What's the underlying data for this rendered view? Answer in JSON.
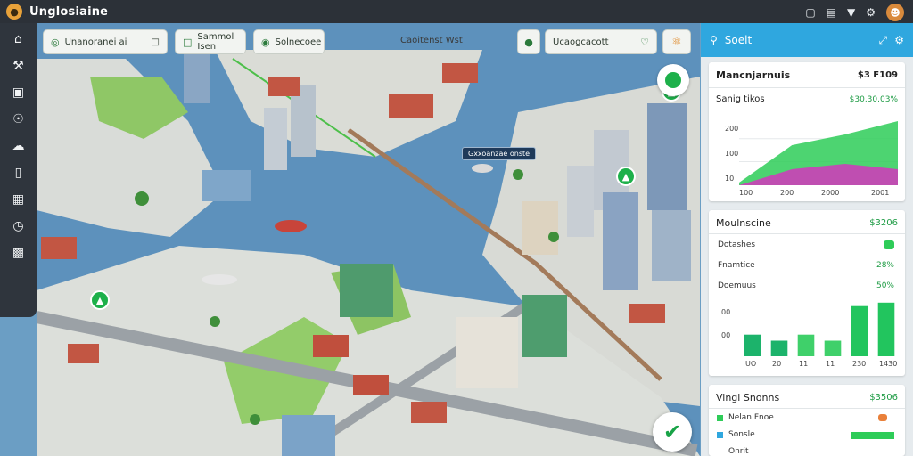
{
  "app": {
    "title": "Unglosiaine"
  },
  "topbar_icons": [
    "window-icon",
    "document-icon",
    "shield-icon",
    "settings-icon"
  ],
  "map_chips": [
    {
      "icon": "compass-icon",
      "label": "Unanoranei ai"
    },
    {
      "icon": "calendar-icon",
      "label": "Sammol Isen"
    },
    {
      "icon": "map-icon",
      "label": "Solnecoee"
    }
  ],
  "map_top_text": "Caoitenst Wst",
  "map_chip_right": {
    "label": "Ucaogcacott"
  },
  "map_callout": "Gxxoanzae onste",
  "side": {
    "header": "Soelt",
    "card1": {
      "title": "Mancnjarnuis",
      "value": "$3 F109",
      "subtitle": "Sanig tikos",
      "subvalue": "$30.30.03%",
      "yticks": [
        "200",
        "100",
        "10"
      ],
      "xticks": [
        "100",
        "200",
        "2000",
        "2001"
      ]
    },
    "card2": {
      "title": "Moulnscine",
      "value": "$3206",
      "rows": [
        {
          "label": "Dotashes",
          "value": ""
        },
        {
          "label": "Fnamtice",
          "value": "28%"
        },
        {
          "label": "Doemuus",
          "value": "50%"
        }
      ],
      "yticks": [
        "00",
        "00"
      ],
      "xticks": [
        "UO",
        "20",
        "11",
        "11",
        "230",
        "1430"
      ]
    },
    "card3": {
      "title": "Vingl Snonns",
      "value": "$3506",
      "rows": [
        {
          "label": "Nelan Fnoe"
        },
        {
          "label": "Sonsle"
        },
        {
          "label": "Onrit"
        }
      ]
    }
  },
  "chart_data": [
    {
      "type": "area",
      "title": "Mancnjarnuis",
      "subtitle": "Sanig tikos",
      "x": [
        "100",
        "200",
        "2000",
        "2001"
      ],
      "series": [
        {
          "values": [
            0,
            60,
            80,
            60
          ]
        },
        {
          "values": [
            10,
            150,
            190,
            240
          ]
        }
      ],
      "yticks": [
        "10",
        "100",
        "200"
      ],
      "ylim": [
        0,
        260
      ],
      "grid": true,
      "legend": "none"
    },
    {
      "type": "bar",
      "title": "Moulnscine",
      "categories": [
        "UO",
        "20",
        "11",
        "11",
        "230",
        "1430"
      ],
      "values": [
        25,
        18,
        25,
        18,
        58,
        62
      ],
      "yticks": [
        "00",
        "00"
      ],
      "ylim": [
        0,
        70
      ],
      "grid": true
    }
  ],
  "colors": {
    "accent": "#2fa7df",
    "positive": "#1f9c45",
    "chart_green": "#2ecc58",
    "chart_magenta": "#cc3fb8",
    "water": "#5d91bc"
  }
}
